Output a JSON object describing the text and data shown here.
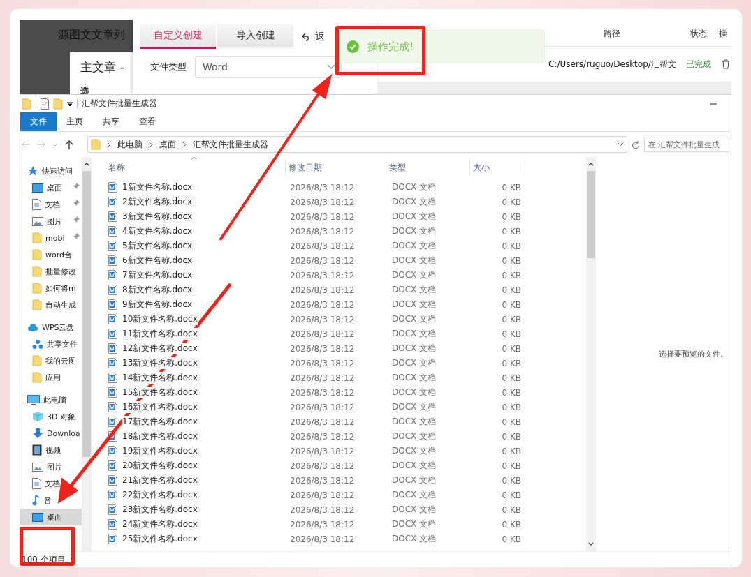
{
  "background_app": {
    "list_title": "源图文文章列",
    "dialog_title": "主文章 -",
    "dialog_label": "选",
    "tabs": [
      {
        "label": "自定义创建",
        "selected": true
      },
      {
        "label": "导入创建",
        "selected": false
      }
    ],
    "back_button": "返",
    "file_type": {
      "label": "文件类型",
      "value": "Word"
    },
    "table": {
      "columns": [
        "路径",
        "状态",
        "操"
      ],
      "rows": [
        {
          "path": "C:/Users/ruguo/Desktop/汇帮文",
          "status": "已完成"
        }
      ]
    }
  },
  "toast": {
    "message": "操作完成!"
  },
  "explorer": {
    "title": "汇帮文件批量生成器",
    "ribbon_tabs": [
      {
        "label": "文件",
        "selected": true
      },
      {
        "label": "主页",
        "selected": false
      },
      {
        "label": "共享",
        "selected": false
      },
      {
        "label": "查看",
        "selected": false
      }
    ],
    "breadcrumb": [
      "此电脑",
      "桌面",
      "汇帮文件批量生成器"
    ],
    "search": {
      "placeholder": "在 汇帮文件批量生成"
    },
    "nav": [
      {
        "label": "快速访问",
        "kind": "star",
        "pinned": false,
        "selected": false
      },
      {
        "label": "桌面",
        "kind": "desktop",
        "pinned": true,
        "selected": false
      },
      {
        "label": "文档",
        "kind": "document",
        "pinned": true,
        "selected": false
      },
      {
        "label": "图片",
        "kind": "picture",
        "pinned": true,
        "selected": false
      },
      {
        "label": "mobi",
        "kind": "folder",
        "pinned": true,
        "selected": false
      },
      {
        "label": "word合",
        "kind": "folder",
        "pinned": false,
        "selected": false
      },
      {
        "label": "批量修改",
        "kind": "folder",
        "pinned": false,
        "selected": false
      },
      {
        "label": "如何将m",
        "kind": "folder",
        "pinned": false,
        "selected": false
      },
      {
        "label": "自动生成",
        "kind": "folder",
        "pinned": false,
        "selected": false
      },
      {
        "label": "WPS云盘",
        "kind": "cloud",
        "pinned": false,
        "selected": false
      },
      {
        "label": "共享文件",
        "kind": "share",
        "pinned": false,
        "selected": false
      },
      {
        "label": "我的云图",
        "kind": "folder",
        "pinned": false,
        "selected": false
      },
      {
        "label": "应用",
        "kind": "folder",
        "pinned": false,
        "selected": false
      },
      {
        "label": "此电脑",
        "kind": "computer",
        "pinned": false,
        "selected": false
      },
      {
        "label": "3D 对象",
        "kind": "cube",
        "pinned": false,
        "selected": false
      },
      {
        "label": "Downloa",
        "kind": "download",
        "pinned": false,
        "selected": false
      },
      {
        "label": "视频",
        "kind": "video",
        "pinned": false,
        "selected": false
      },
      {
        "label": "图片",
        "kind": "picture",
        "pinned": false,
        "selected": false
      },
      {
        "label": "文档",
        "kind": "document",
        "pinned": false,
        "selected": false
      },
      {
        "label": "音",
        "kind": "music",
        "pinned": false,
        "selected": false
      },
      {
        "label": "桌面",
        "kind": "desktop",
        "pinned": false,
        "selected": true
      }
    ],
    "columns": [
      "名称",
      "修改日期",
      "类型",
      "大小"
    ],
    "rows": [
      {
        "name": "1新文件名称.docx",
        "modified": "2026/8/3 18:12",
        "type": "DOCX 文档",
        "size": "0 KB"
      },
      {
        "name": "2新文件名称.docx",
        "modified": "2026/8/3 18:12",
        "type": "DOCX 文档",
        "size": "0 KB"
      },
      {
        "name": "3新文件名称.docx",
        "modified": "2026/8/3 18:12",
        "type": "DOCX 文档",
        "size": "0 KB"
      },
      {
        "name": "4新文件名称.docx",
        "modified": "2026/8/3 18:12",
        "type": "DOCX 文档",
        "size": "0 KB"
      },
      {
        "name": "5新文件名称.docx",
        "modified": "2026/8/3 18:12",
        "type": "DOCX 文档",
        "size": "0 KB"
      },
      {
        "name": "6新文件名称.docx",
        "modified": "2026/8/3 18:12",
        "type": "DOCX 文档",
        "size": "0 KB"
      },
      {
        "name": "7新文件名称.docx",
        "modified": "2026/8/3 18:12",
        "type": "DOCX 文档",
        "size": "0 KB"
      },
      {
        "name": "8新文件名称.docx",
        "modified": "2026/8/3 18:12",
        "type": "DOCX 文档",
        "size": "0 KB"
      },
      {
        "name": "9新文件名称.docx",
        "modified": "2026/8/3 18:12",
        "type": "DOCX 文档",
        "size": "0 KB"
      },
      {
        "name": "10新文件名称.docx",
        "modified": "2026/8/3 18:12",
        "type": "DOCX 文档",
        "size": "0 KB"
      },
      {
        "name": "11新文件名称.docx",
        "modified": "2026/8/3 18:12",
        "type": "DOCX 文档",
        "size": "0 KB"
      },
      {
        "name": "12新文件名称.docx",
        "modified": "2026/8/3 18:12",
        "type": "DOCX 文档",
        "size": "0 KB"
      },
      {
        "name": "13新文件名称.docx",
        "modified": "2026/8/3 18:12",
        "type": "DOCX 文档",
        "size": "0 KB"
      },
      {
        "name": "14新文件名称.docx",
        "modified": "2026/8/3 18:12",
        "type": "DOCX 文档",
        "size": "0 KB"
      },
      {
        "name": "15新文件名称.docx",
        "modified": "2026/8/3 18:12",
        "type": "DOCX 文档",
        "size": "0 KB"
      },
      {
        "name": "16新文件名称.docx",
        "modified": "2026/8/3 18:12",
        "type": "DOCX 文档",
        "size": "0 KB"
      },
      {
        "name": "17新文件名称.docx",
        "modified": "2026/8/3 18:12",
        "type": "DOCX 文档",
        "size": "0 KB"
      },
      {
        "name": "18新文件名称.docx",
        "modified": "2026/8/3 18:12",
        "type": "DOCX 文档",
        "size": "0 KB"
      },
      {
        "name": "19新文件名称.docx",
        "modified": "2026/8/3 18:12",
        "type": "DOCX 文档",
        "size": "0 KB"
      },
      {
        "name": "20新文件名称.docx",
        "modified": "2026/8/3 18:12",
        "type": "DOCX 文档",
        "size": "0 KB"
      },
      {
        "name": "21新文件名称.docx",
        "modified": "2026/8/3 18:12",
        "type": "DOCX 文档",
        "size": "0 KB"
      },
      {
        "name": "22新文件名称.docx",
        "modified": "2026/8/3 18:12",
        "type": "DOCX 文档",
        "size": "0 KB"
      },
      {
        "name": "23新文件名称.docx",
        "modified": "2026/8/3 18:12",
        "type": "DOCX 文档",
        "size": "0 KB"
      },
      {
        "name": "24新文件名称.docx",
        "modified": "2026/8/3 18:12",
        "type": "DOCX 文档",
        "size": "0 KB"
      },
      {
        "name": "25新文件名称.docx",
        "modified": "2026/8/3 18:12",
        "type": "DOCX 文档",
        "size": "0 KB"
      }
    ],
    "preview_message": "选择要预览的文件。",
    "status": "100 个项目"
  }
}
